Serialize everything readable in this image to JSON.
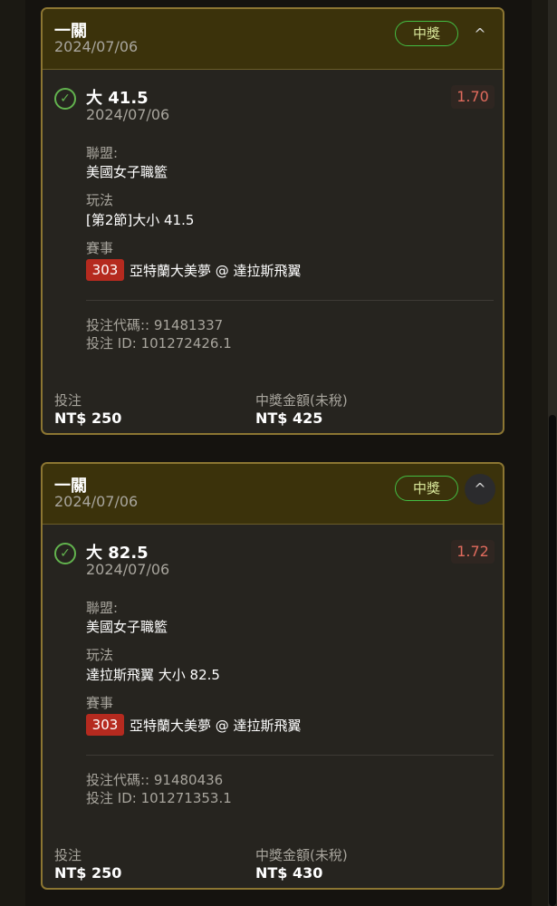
{
  "cards": [
    {
      "header": {
        "title": "一關",
        "date": "2024/07/06",
        "status": "中獎",
        "collapse_icon": "^"
      },
      "selection": {
        "title": "大 41.5",
        "date": "2024/07/06",
        "odds": "1.70",
        "check_icon": "✓"
      },
      "league": {
        "label": "聯盟:",
        "value": "美國女子職籃"
      },
      "play": {
        "label": "玩法",
        "value": "[第2節]大小 41.5"
      },
      "event": {
        "label": "賽事",
        "code": "303",
        "name": "亞特蘭大美夢 @ 達拉斯飛翼"
      },
      "refs": {
        "bet_code": "投注代碼:: 91481337",
        "bet_id": "投注 ID: 101272426.1"
      },
      "footer": {
        "stake_label": "投注",
        "stake_value": "NT$ 250",
        "payout_label": "中獎金額(未稅)",
        "payout_value": "NT$ 425"
      }
    },
    {
      "header": {
        "title": "一關",
        "date": "2024/07/06",
        "status": "中獎",
        "collapse_icon": "^"
      },
      "selection": {
        "title": "大 82.5",
        "date": "2024/07/06",
        "odds": "1.72",
        "check_icon": "✓"
      },
      "league": {
        "label": "聯盟:",
        "value": "美國女子職籃"
      },
      "play": {
        "label": "玩法",
        "value": "達拉斯飛翼 大小 82.5"
      },
      "event": {
        "label": "賽事",
        "code": "303",
        "name": "亞特蘭大美夢 @ 達拉斯飛翼"
      },
      "refs": {
        "bet_code": "投注代碼:: 91480436",
        "bet_id": "投注 ID: 101271353.1"
      },
      "footer": {
        "stake_label": "投注",
        "stake_value": "NT$ 250",
        "payout_label": "中獎金額(未稅)",
        "payout_value": "NT$ 430"
      }
    }
  ],
  "colors": {
    "accent_gold": "#8c7632",
    "win_green": "#43bd43",
    "odds_red": "#e06b5d",
    "event_red": "#b52a1f"
  }
}
